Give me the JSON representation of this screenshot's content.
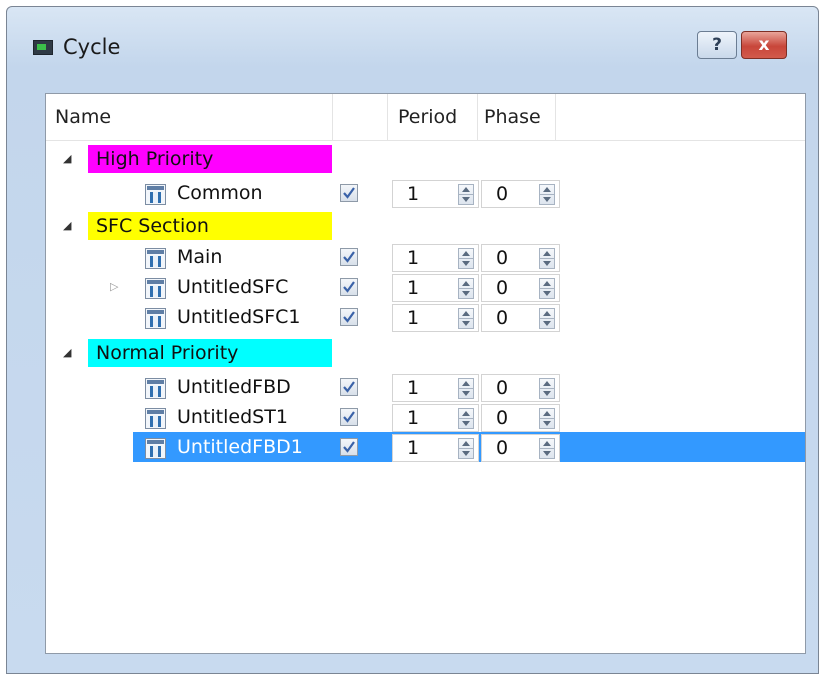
{
  "window": {
    "title": "Cycle",
    "icon": "window-app-icon",
    "help_label": "?",
    "close_label": "x"
  },
  "columns": {
    "name": "Name",
    "enabled": "",
    "period": "Period",
    "phase": "Phase"
  },
  "groups": [
    {
      "label": "High Priority",
      "color": "#ff00ff",
      "expanded": true
    },
    {
      "label": "SFC Section",
      "color": "#ffff00",
      "expanded": true
    },
    {
      "label": "Normal Priority",
      "color": "#00ffff",
      "expanded": true
    }
  ],
  "items": [
    {
      "name": "Common",
      "checked": true,
      "period": "1",
      "phase": "0"
    },
    {
      "name": "Main",
      "checked": true,
      "period": "1",
      "phase": "0"
    },
    {
      "name": "UntitledSFC",
      "checked": true,
      "period": "1",
      "phase": "0",
      "expandable": true
    },
    {
      "name": "UntitledSFC1",
      "checked": true,
      "period": "1",
      "phase": "0"
    },
    {
      "name": "UntitledFBD",
      "checked": true,
      "period": "1",
      "phase": "0"
    },
    {
      "name": "UntitledST1",
      "checked": true,
      "period": "1",
      "phase": "0"
    },
    {
      "name": "UntitledFBD1",
      "checked": true,
      "period": "1",
      "phase": "0",
      "selected": true
    }
  ],
  "colors": {
    "selection": "#3399ff",
    "title_bar": "#c3d6ec"
  },
  "icons": {
    "item": "program-block-icon",
    "expanded": "expanded-triangle-icon",
    "collapsed": "collapsed-triangle-icon",
    "check": "checkmark-icon"
  }
}
